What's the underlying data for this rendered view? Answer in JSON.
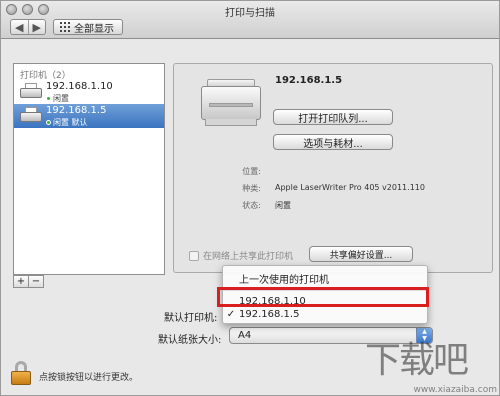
{
  "window": {
    "title": "打印与扫描"
  },
  "toolbar": {
    "back_glyph": "◀",
    "forward_glyph": "▶",
    "show_all_label": "全部显示"
  },
  "sidebar": {
    "header": "打印机（2）",
    "printers": [
      {
        "name": "192.168.1.10",
        "status": "闲置",
        "selected": false
      },
      {
        "name": "192.168.1.5",
        "status": "闲置 默认",
        "selected": true
      }
    ],
    "add_glyph": "+",
    "remove_glyph": "−"
  },
  "details": {
    "printer_name": "192.168.1.5",
    "open_queue_label": "打开打印队列...",
    "options_label": "选项与耗材...",
    "location_label": "位置:",
    "location_value": "",
    "kind_label": "种类:",
    "kind_value": "Apple LaserWriter Pro 405 v2011.110",
    "status_label": "状态:",
    "status_value": "闲置",
    "share_label": "在网络上共享此打印机",
    "share_prefs_label": "共享偏好设置..."
  },
  "default_printer": {
    "label": "默认打印机:",
    "menu": [
      {
        "label": "上一次使用的打印机",
        "checked": false
      },
      {
        "label": "192.168.1.10",
        "checked": false
      },
      {
        "label": "192.168.1.5",
        "checked": true
      }
    ],
    "check_glyph": "✓"
  },
  "paper": {
    "label": "默认纸张大小:",
    "value": "A4"
  },
  "lock": {
    "text": "点按锁按钮以进行更改。"
  },
  "watermark": {
    "main": "下载吧",
    "sub": "www.xiazaiba.com"
  },
  "colors": {
    "selection": "#3a73c0",
    "highlight": "#d81e1e",
    "status_ok": "#3fae3f"
  }
}
